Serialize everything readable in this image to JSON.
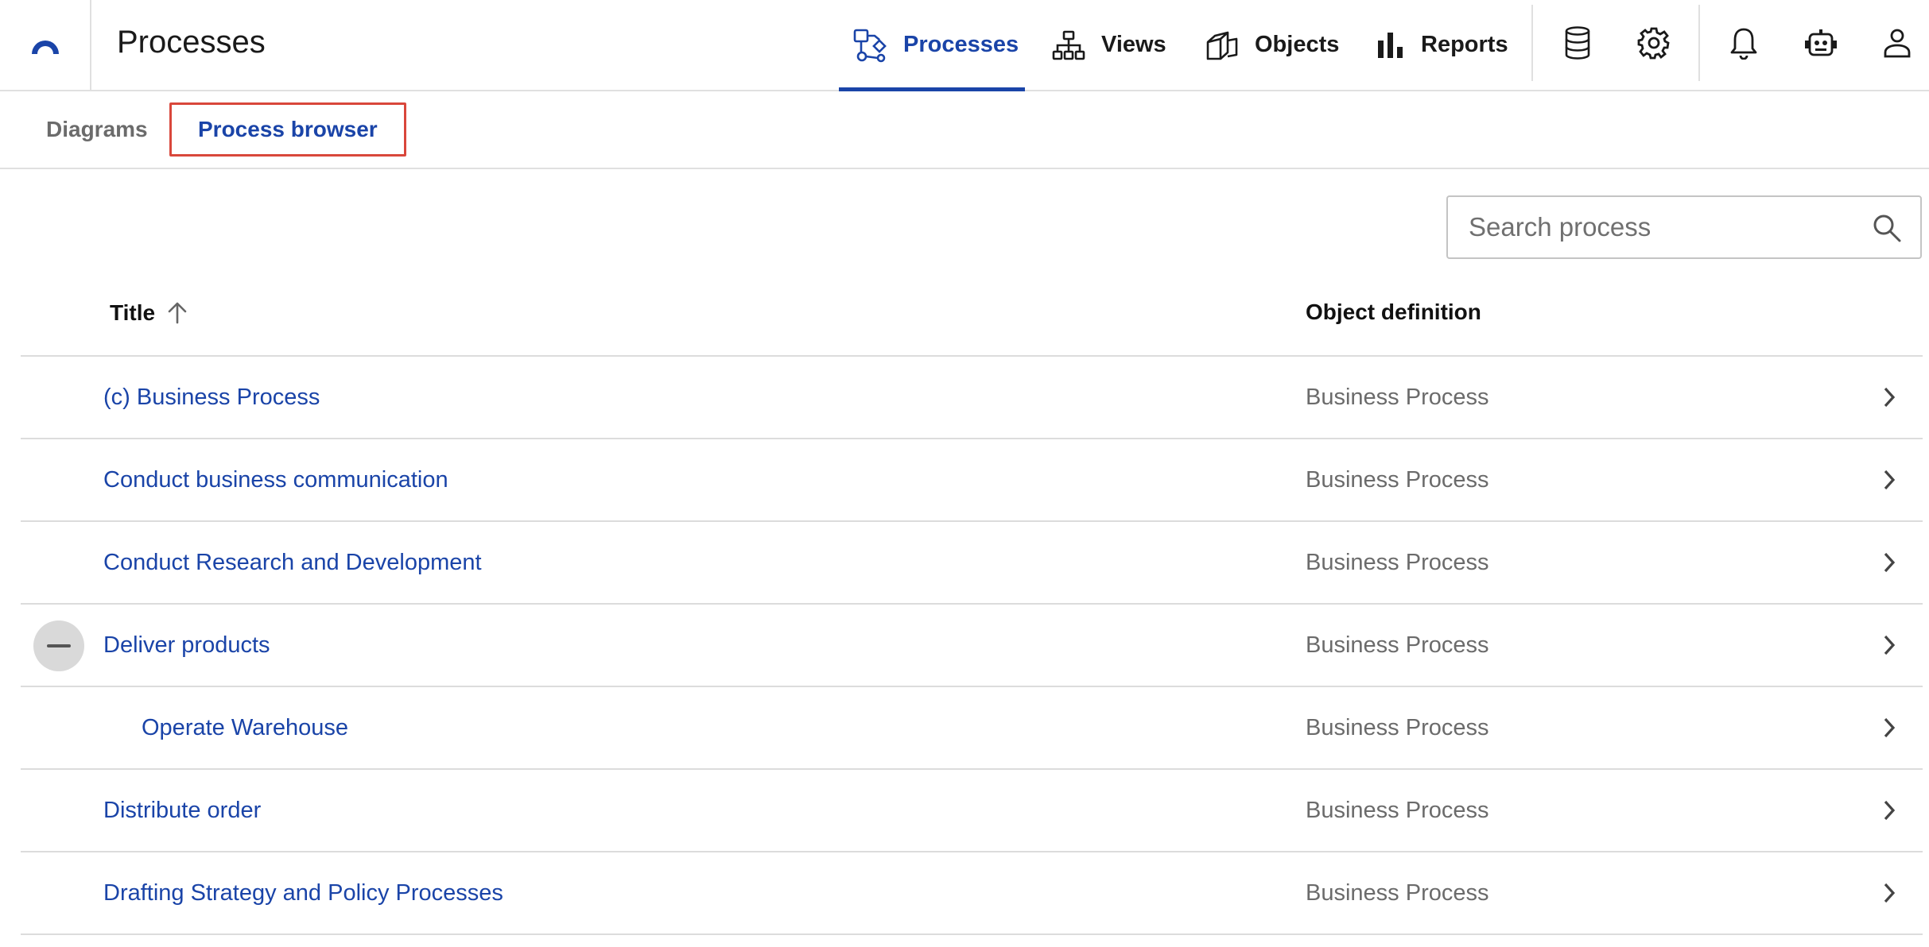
{
  "app": {
    "title": "Processes"
  },
  "nav": {
    "tabs": [
      {
        "label": "Processes",
        "icon": "process-icon",
        "active": true
      },
      {
        "label": "Views",
        "icon": "hierarchy-icon",
        "active": false
      },
      {
        "label": "Objects",
        "icon": "cube-icon",
        "active": false
      },
      {
        "label": "Reports",
        "icon": "bar-chart-icon",
        "active": false
      }
    ],
    "icons": [
      "database-icon",
      "gear-icon",
      "bell-icon",
      "robot-icon",
      "user-icon"
    ]
  },
  "subtabs": [
    {
      "label": "Diagrams",
      "active": false
    },
    {
      "label": "Process browser",
      "active": true
    }
  ],
  "search": {
    "placeholder": "Search process",
    "value": ""
  },
  "table": {
    "columns": {
      "title": "Title",
      "definition": "Object definition"
    },
    "sort": "ascending",
    "rows": [
      {
        "title": "(c) Business Process",
        "definition": "Business Process",
        "level": 0,
        "expanded": false
      },
      {
        "title": "Conduct business communication",
        "definition": "Business Process",
        "level": 0,
        "expanded": false
      },
      {
        "title": "Conduct Research and Development",
        "definition": "Business Process",
        "level": 0,
        "expanded": false
      },
      {
        "title": "Deliver products",
        "definition": "Business Process",
        "level": 0,
        "expanded": true
      },
      {
        "title": "Operate Warehouse",
        "definition": "Business Process",
        "level": 1,
        "expanded": false
      },
      {
        "title": "Distribute order",
        "definition": "Business Process",
        "level": 0,
        "expanded": false
      },
      {
        "title": "Drafting Strategy and Policy Processes",
        "definition": "Business Process",
        "level": 0,
        "expanded": false
      }
    ]
  },
  "colors": {
    "accent": "#1a44a8",
    "highlight_border": "#d9473b",
    "muted_text": "#6b6b6b",
    "divider": "#dcdcdc"
  }
}
